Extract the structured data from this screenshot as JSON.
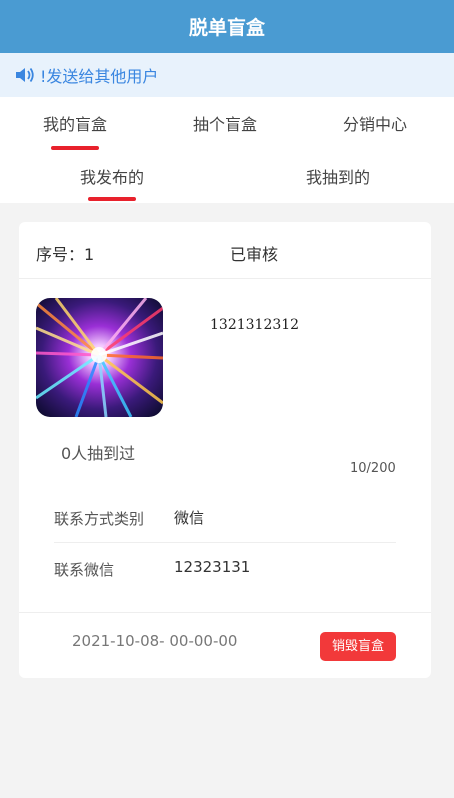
{
  "header": {
    "title": "脱单盲盒"
  },
  "notice": {
    "icon": "speaker-icon",
    "text": "!发送给其他用户"
  },
  "tabs": [
    {
      "label": "我的盲盒",
      "active": true
    },
    {
      "label": "抽个盲盒",
      "active": false
    },
    {
      "label": "分销中心",
      "active": false
    }
  ],
  "subtabs": [
    {
      "label": "我发布的",
      "active": true
    },
    {
      "label": "我抽到的",
      "active": false
    }
  ],
  "card": {
    "seq_label": "序号：1",
    "status": "已审核",
    "code": "1321312312",
    "drawn_text": "0人抽到过",
    "ratio": "10/200",
    "contact_type_label": "联系方式类别",
    "contact_type_value": "微信",
    "contact_wechat_label": "联系微信",
    "contact_wechat_value": "12323131",
    "date": "2021-10-08- 00-00-00",
    "destroy_label": "销毁盲盒"
  },
  "colors": {
    "header": "#4a9bd2",
    "accent": "#e8212c",
    "notice_text": "#3a86e0",
    "button": "#f2393a"
  }
}
